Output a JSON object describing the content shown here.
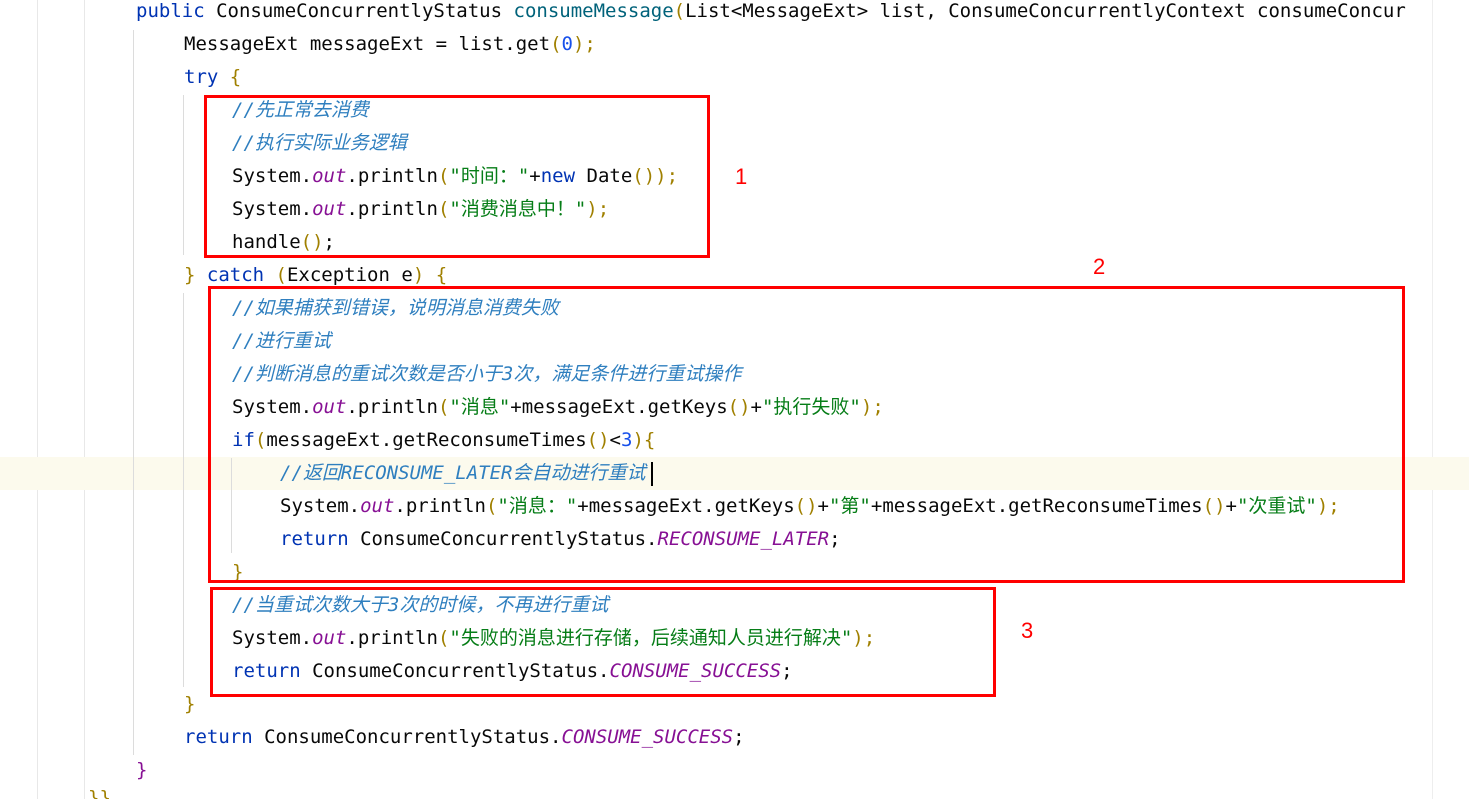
{
  "lines": [
    {
      "id": "l1",
      "parts": [
        "public ",
        "ConsumeConcurrentlyStatus ",
        "consumeMessage",
        "(",
        "List<MessageExt> list, ConsumeConcurrentlyContext consumeConcur"
      ]
    },
    {
      "id": "l2",
      "parts": [
        "MessageExt messageExt = list.",
        "get",
        "(",
        "0",
        ");"
      ]
    },
    {
      "id": "l3",
      "parts": [
        "try ",
        "{"
      ]
    },
    {
      "id": "l4",
      "text": "//先正常去消费"
    },
    {
      "id": "l5",
      "text": "//执行实际业务逻辑"
    },
    {
      "id": "l6",
      "parts": [
        "System.",
        "out",
        ".",
        "println",
        "(",
        "\"时间：\"",
        "+",
        "new ",
        "Date",
        "()",
        ");"
      ]
    },
    {
      "id": "l7",
      "parts": [
        "System.",
        "out",
        ".",
        "println",
        "(",
        "\"消费消息中！\"",
        ");"
      ]
    },
    {
      "id": "l8",
      "parts": [
        "handle",
        "()",
        ";"
      ]
    },
    {
      "id": "l9",
      "parts": [
        "} ",
        "catch ",
        "(",
        "Exception e",
        ") ",
        "{"
      ]
    },
    {
      "id": "l10",
      "text": "//如果捕获到错误，说明消息消费失败"
    },
    {
      "id": "l11",
      "text": "//进行重试"
    },
    {
      "id": "l12",
      "text": "//判断消息的重试次数是否小于3次，满足条件进行重试操作"
    },
    {
      "id": "l13",
      "parts": [
        "System.",
        "out",
        ".",
        "println",
        "(",
        "\"消息\"",
        "+messageExt.",
        "getKeys",
        "()",
        "+",
        "\"执行失败\"",
        ");"
      ]
    },
    {
      "id": "l14",
      "parts": [
        "if",
        "(",
        "messageExt.",
        "getReconsumeTimes",
        "()",
        "<",
        "3",
        ")",
        "{"
      ]
    },
    {
      "id": "l15",
      "text": "//返回RECONSUME_LATER会自动进行重试"
    },
    {
      "id": "l16",
      "parts": [
        "System.",
        "out",
        ".",
        "println",
        "(",
        "\"消息：\"",
        "+messageExt.",
        "getKeys",
        "()",
        "+",
        "\"第\"",
        "+messageExt.",
        "getReconsumeTimes",
        "()",
        "+",
        "\"次重试\"",
        ");"
      ]
    },
    {
      "id": "l17",
      "parts": [
        "return ",
        "ConsumeConcurrentlyStatus.",
        "RECONSUME_LATER",
        ";"
      ]
    },
    {
      "id": "l18",
      "parts": [
        "}"
      ]
    },
    {
      "id": "l19",
      "text": "//当重试次数大于3次的时候，不再进行重试"
    },
    {
      "id": "l20",
      "parts": [
        "System.",
        "out",
        ".",
        "println",
        "(",
        "\"失败的消息进行存储，后续通知人员进行解决\"",
        ");"
      ]
    },
    {
      "id": "l21",
      "parts": [
        "return ",
        "ConsumeConcurrentlyStatus.",
        "CONSUME_SUCCESS",
        ";"
      ]
    },
    {
      "id": "l22",
      "parts": [
        "}"
      ]
    },
    {
      "id": "l23",
      "parts": [
        "return ",
        "ConsumeConcurrentlyStatus.",
        "CONSUME_SUCCESS",
        ";"
      ]
    },
    {
      "id": "l24",
      "parts": [
        "}"
      ]
    },
    {
      "id": "l25",
      "parts": [
        "}}"
      ]
    }
  ],
  "annotations": {
    "box1_label": "1",
    "box2_label": "2",
    "box3_label": "3",
    "color": "#ff0000"
  }
}
